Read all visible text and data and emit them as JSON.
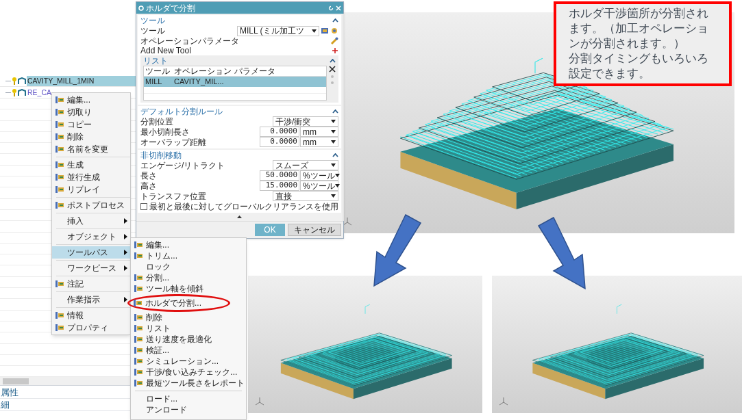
{
  "tree": {
    "items": [
      {
        "label": "CAVITY_MILL_1MIN",
        "selected": true
      },
      {
        "label": "RE_CA",
        "selected": false
      }
    ]
  },
  "context_menu": {
    "items": [
      {
        "kind": "icon_item",
        "label": "編集...",
        "submenu": false,
        "selected": false
      },
      {
        "kind": "icon_item",
        "label": "切取り",
        "submenu": false,
        "selected": false
      },
      {
        "kind": "icon_item",
        "label": "コピー",
        "submenu": false,
        "selected": false
      },
      {
        "kind": "icon_item",
        "label": "削除",
        "submenu": false,
        "selected": false
      },
      {
        "kind": "icon_item",
        "label": "名前を変更",
        "submenu": false,
        "selected": false
      },
      {
        "kind": "separator"
      },
      {
        "kind": "icon_item",
        "label": "生成",
        "submenu": false,
        "selected": false
      },
      {
        "kind": "icon_item",
        "label": "並行生成",
        "submenu": false,
        "selected": false
      },
      {
        "kind": "icon_item",
        "label": "リプレイ",
        "submenu": false,
        "selected": false
      },
      {
        "kind": "separator"
      },
      {
        "kind": "icon_item",
        "label": "ポストプロセス",
        "submenu": false,
        "selected": false
      },
      {
        "kind": "separator"
      },
      {
        "kind": "item",
        "label": "挿入",
        "submenu": true,
        "selected": false
      },
      {
        "kind": "separator"
      },
      {
        "kind": "item",
        "label": "オブジェクト",
        "submenu": true,
        "selected": false
      },
      {
        "kind": "separator"
      },
      {
        "kind": "item",
        "label": "ツールパス",
        "submenu": true,
        "selected": true
      },
      {
        "kind": "separator"
      },
      {
        "kind": "item",
        "label": "ワークピース",
        "submenu": true,
        "selected": false
      },
      {
        "kind": "separator"
      },
      {
        "kind": "icon_item",
        "label": "注記",
        "submenu": false,
        "selected": false
      },
      {
        "kind": "separator"
      },
      {
        "kind": "item",
        "label": "作業指示",
        "submenu": true,
        "selected": false
      },
      {
        "kind": "separator"
      },
      {
        "kind": "icon_item",
        "label": "情報",
        "submenu": false,
        "selected": false
      },
      {
        "kind": "icon_item",
        "label": "プロパティ",
        "submenu": false,
        "selected": false
      }
    ]
  },
  "submenu": {
    "items": [
      {
        "kind": "icon_item",
        "label": "編集...",
        "highlighted": false
      },
      {
        "kind": "icon_item",
        "label": "トリム...",
        "highlighted": false
      },
      {
        "kind": "item",
        "label": "ロック",
        "highlighted": false
      },
      {
        "kind": "icon_item",
        "label": "分割...",
        "highlighted": false
      },
      {
        "kind": "icon_item",
        "label": "ツール軸を傾斜",
        "highlighted": false
      },
      {
        "kind": "icon_item",
        "label": "ホルダで分割...",
        "highlighted": true
      },
      {
        "kind": "icon_item",
        "label": "削除",
        "highlighted": false
      },
      {
        "kind": "icon_item",
        "label": "リスト",
        "highlighted": false
      },
      {
        "kind": "icon_item",
        "label": "送り速度を最適化",
        "highlighted": false
      },
      {
        "kind": "icon_item",
        "label": "検証...",
        "highlighted": false
      },
      {
        "kind": "icon_item",
        "label": "シミュレーション...",
        "highlighted": false
      },
      {
        "kind": "icon_item",
        "label": "干渉/食い込みチェック...",
        "highlighted": false
      },
      {
        "kind": "icon_item",
        "label": "最短ツール長さをレポート",
        "highlighted": false
      },
      {
        "kind": "separator"
      },
      {
        "kind": "item",
        "label": "ロード...",
        "highlighted": false
      },
      {
        "kind": "item",
        "label": "アンロード",
        "highlighted": false
      }
    ]
  },
  "bottom_panel": {
    "headings": [
      "属性",
      "細"
    ]
  },
  "dialog": {
    "title": "ホルダで分割",
    "tool_section": {
      "title": "ツール",
      "expanded": true,
      "tool_label": "ツール",
      "tool_value": "MILL (ミル加工ツ",
      "op_params_label": "オペレーションパラメータ",
      "add_tool_label": "Add New Tool",
      "list": {
        "title": "リスト",
        "expanded": true,
        "columns": [
          "ツール",
          "オペレーション",
          "パラメータ"
        ],
        "rows": [
          {
            "cells": [
              "MILL",
              "CAVITY_MIL..."
            ],
            "selected": true
          }
        ]
      }
    },
    "rule_section": {
      "title": "デフォルト分割ルール",
      "expanded": true,
      "rows": [
        {
          "kind": "dropdown",
          "label": "分割位置",
          "value": "干渉/衝突"
        },
        {
          "kind": "number",
          "label": "最小切削長さ",
          "value": "0.0000",
          "unit": "mm"
        },
        {
          "kind": "number",
          "label": "オーバラップ距離",
          "value": "0.0000",
          "unit": "mm"
        }
      ]
    },
    "non_cut_section": {
      "title": "非切削移動",
      "expanded": true,
      "rows": [
        {
          "kind": "dropdown",
          "label": "エンゲージ/リトラクト",
          "value": "スムーズ"
        },
        {
          "kind": "number",
          "label": "長さ",
          "value": "50.0000",
          "unit": "%ツール"
        },
        {
          "kind": "number",
          "label": "高さ",
          "value": "15.0000",
          "unit": "%ツール"
        },
        {
          "kind": "dropdown",
          "label": "トランスファ位置",
          "value": "直接"
        }
      ],
      "checkbox": {
        "label": "最初と最後に対してグローバルクリアランスを使用",
        "checked": false
      }
    },
    "buttons": [
      "OK",
      "キャンセル"
    ]
  },
  "callout": {
    "lines": [
      "ホルダ干渉箇所が分割されます。（加工オペレーションが分割されます。）",
      "分割タイミングもいろいろ設定できます。"
    ]
  }
}
